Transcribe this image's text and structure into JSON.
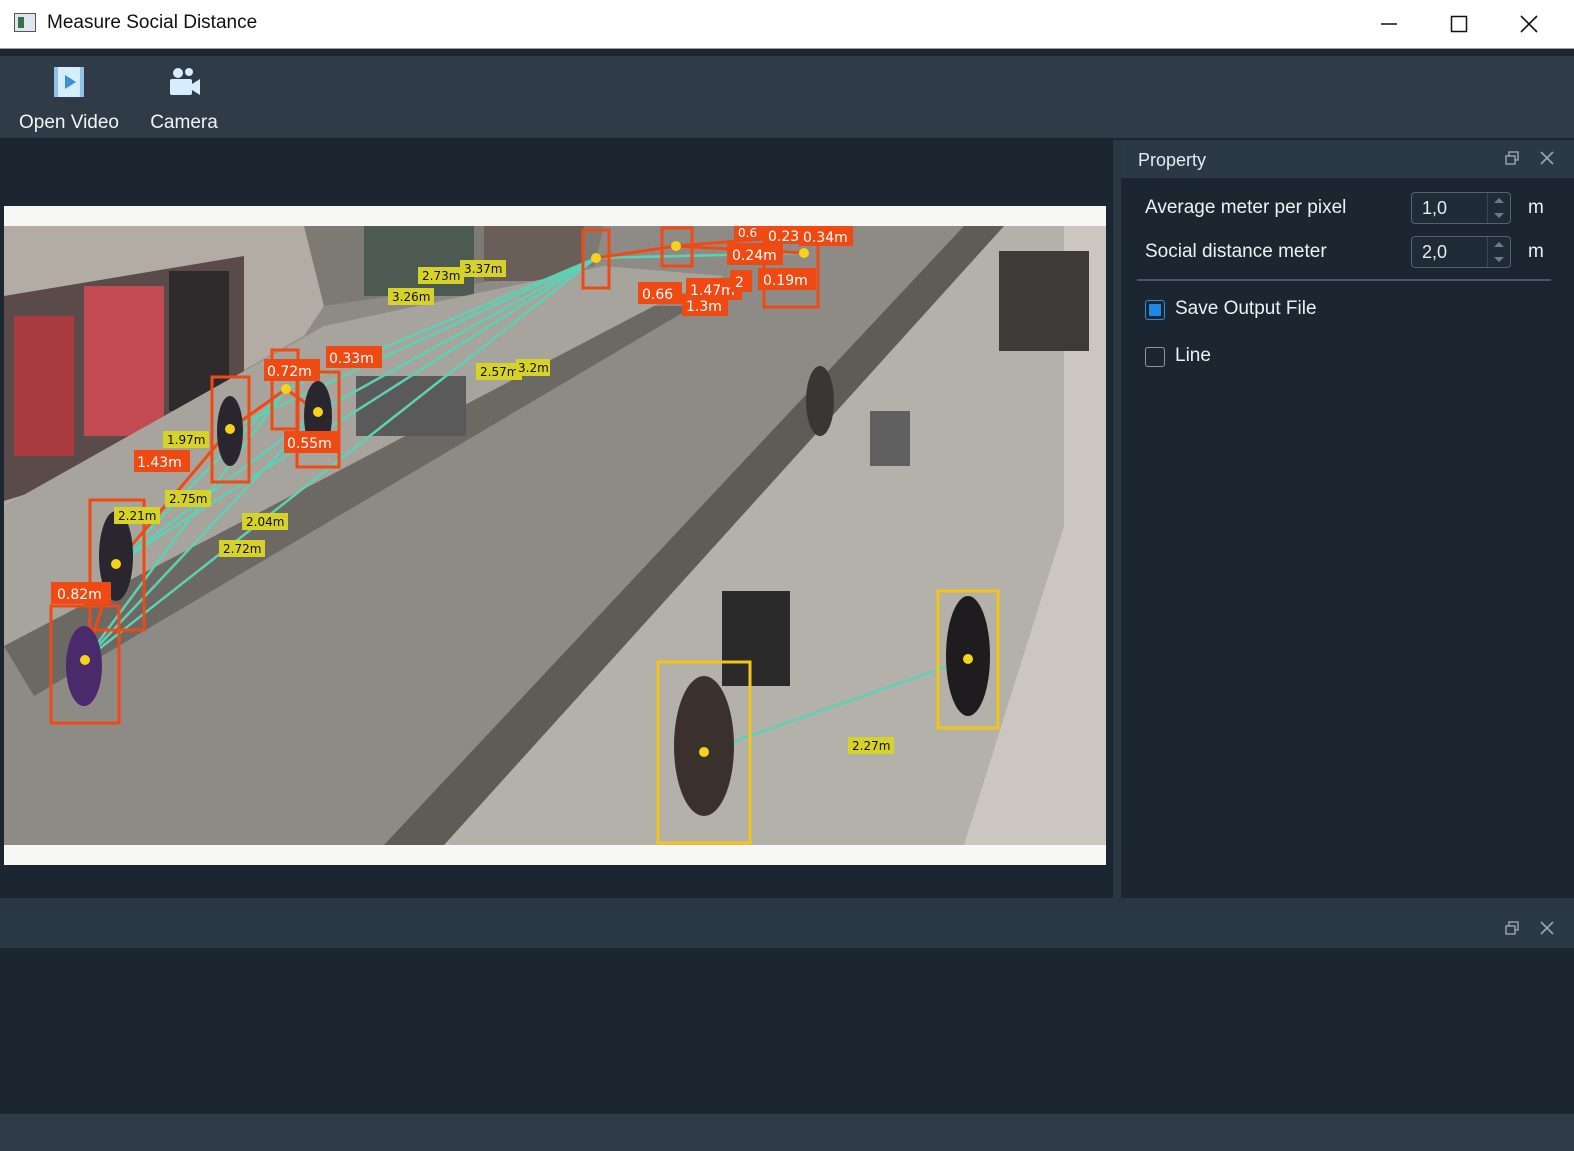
{
  "window": {
    "title": "Measure Social Distance",
    "controls": [
      "minimize-icon",
      "maximize-icon",
      "close-icon"
    ]
  },
  "toolbar": {
    "open_video_label": "Open Video",
    "camera_label": "Camera"
  },
  "property_panel": {
    "title": "Property",
    "avg_meter_label": "Average meter per pixel",
    "avg_meter_value": "1,0",
    "avg_meter_unit": "m",
    "social_distance_label": "Social distance meter",
    "social_distance_value": "2,0",
    "social_distance_unit": "m",
    "save_output_label": "Save Output File",
    "save_output_checked": true,
    "line_label": "Line",
    "line_checked": false
  },
  "video": {
    "violation_color": "#f04a14",
    "safe_color": "#f2c51a",
    "link_color": "#5ed1b4",
    "violation_labels": [
      "0.82m",
      "1.43m",
      "0.72m",
      "0.33m",
      "0.55m",
      "0.66",
      "1.47m",
      "1.3m",
      "0.24m",
      "0.19m",
      "0.23",
      "0.34m",
      "0.6",
      "2"
    ],
    "distance_labels": [
      "1.97m",
      "2.75m",
      "2.21m",
      "2.04m",
      "2.72m",
      "2.73m",
      "3.37m",
      "3.26m",
      "2.57m",
      "3.2m",
      "2.27m"
    ]
  },
  "colors": {
    "background": "#1b2631",
    "toolbar": "#2f3b47",
    "accent": "#1e88e5"
  }
}
